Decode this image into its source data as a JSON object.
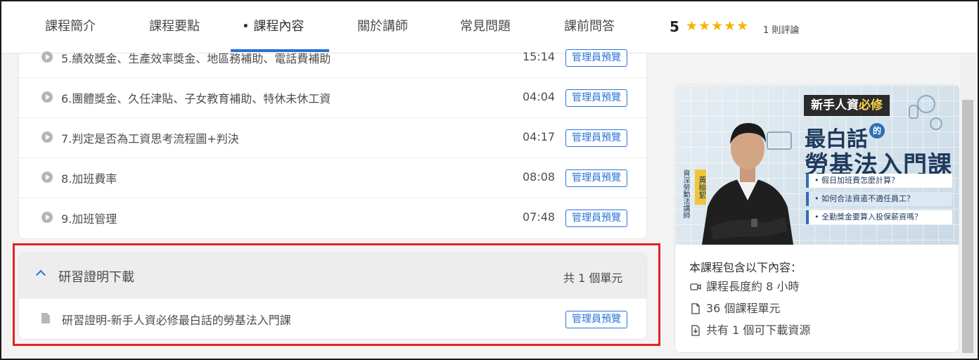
{
  "nav": {
    "tabs": [
      {
        "label": "課程簡介"
      },
      {
        "label": "課程要點"
      },
      {
        "label": "• 課程內容"
      },
      {
        "label": "關於講師"
      },
      {
        "label": "常見問題"
      },
      {
        "label": "課前問答"
      }
    ],
    "rating": {
      "score": "5",
      "stars": "★★★★★",
      "count": "1 則評論",
      "star_color": "#f4b400"
    }
  },
  "lessons": [
    {
      "title": "5.績效獎金、生產效率獎金、地區務補助、電話費補助",
      "duration": "15:14",
      "badge": "管理員預覽"
    },
    {
      "title": "6.團體獎金、久任津貼、子女教育補助、特休未休工資",
      "duration": "04:04",
      "badge": "管理員預覽"
    },
    {
      "title": "7.判定是否為工資思考流程圖+判決",
      "duration": "04:17",
      "badge": "管理員預覽"
    },
    {
      "title": "8.加班費率",
      "duration": "08:08",
      "badge": "管理員預覽"
    },
    {
      "title": "9.加班管理",
      "duration": "07:48",
      "badge": "管理員預覽"
    }
  ],
  "section": {
    "title": "研習證明下載",
    "count": "共 1 個單元",
    "items": [
      {
        "title": "研習證明-新手人資必修最白話的勞基法入門課",
        "badge": "管理員預覽"
      }
    ]
  },
  "sidebar": {
    "banner": {
      "tag_prefix": "新手人資",
      "tag_highlight": "必修",
      "line1": "最白話",
      "line1_dot": "的",
      "line2": "勞基法入門課",
      "bullets": [
        "• 假日加班費怎麼計算？",
        "• 如何合法資遣不適任員工？",
        "• 全勤獎金要算入投保薪資嗎？"
      ],
      "instructor_title": "資深勞動法講師",
      "instructor_name": "黃榆絜"
    },
    "includes_heading": "本課程包含以下內容：",
    "includes": [
      {
        "icon": "video-icon",
        "text": "課程長度約 8 小時"
      },
      {
        "icon": "file-icon",
        "text": "36 個課程單元"
      },
      {
        "icon": "download-icon",
        "text": "共有 1 個可下載資源"
      }
    ]
  },
  "colors": {
    "accent": "#2a74d8",
    "highlight_border": "#e02424"
  }
}
